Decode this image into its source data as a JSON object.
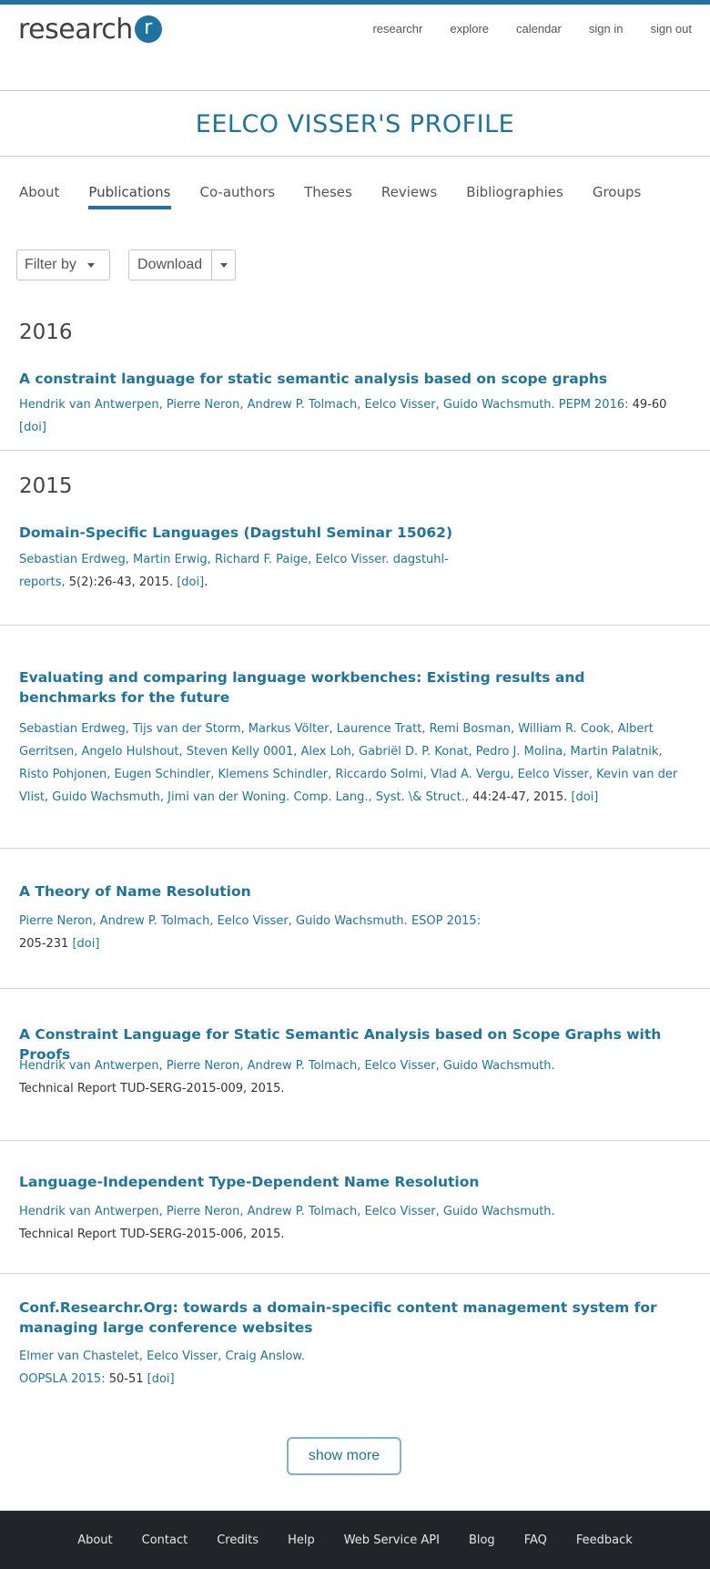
{
  "logo": {
    "text": "research",
    "badge": "r"
  },
  "topnav": [
    "researchr",
    "explore",
    "calendar",
    "sign in",
    "sign out"
  ],
  "page_title": "EELCO VISSER'S PROFILE",
  "tabs": [
    {
      "label": "About",
      "active": false
    },
    {
      "label": "Publications",
      "active": true
    },
    {
      "label": "Co-authors",
      "active": false
    },
    {
      "label": "Theses",
      "active": false
    },
    {
      "label": "Reviews",
      "active": false
    },
    {
      "label": "Bibliographies",
      "active": false
    },
    {
      "label": "Groups",
      "active": false
    }
  ],
  "filter_label": "Filter by",
  "download_label": "Download",
  "years": [
    "2016",
    "2015"
  ],
  "pubs": [
    {
      "title": "A constraint language for static semantic analysis based on scope graphs",
      "authors": "Hendrik van Antwerpen, Pierre Neron, Andrew P. Tolmach, Eelco Visser, Guido Wachsmuth.",
      "venue": "PEPM 2016:",
      "rest": " 49-60 ",
      "doi": "[doi]"
    },
    {
      "title": "Domain-Specific Languages (Dagstuhl Seminar 15062)",
      "authors": "Sebastian Erdweg, Martin Erwig, Richard F. Paige, Eelco Visser.",
      "venue": "dagstuhl-reports,",
      "rest": "5(2):26-43, 2015. ",
      "doi": "[doi]",
      "tail": "."
    },
    {
      "title": "Evaluating and comparing language workbenches: Existing results and benchmarks for the future",
      "authors": "Sebastian Erdweg, Tijs van der Storm, Markus Völter, Laurence Tratt, Remi Bosman, William R. Cook, Albert Gerritsen, Angelo Hulshout, Steven Kelly 0001, Alex Loh, Gabriël D. P. Konat, Pedro J. Molina, Martin Palatnik, Risto Pohjonen, Eugen Schindler, Klemens Schindler, Riccardo Solmi, Vlad A. Vergu, Eelco Visser, Kevin van der Vlist, Guido Wachsmuth, Jimi van der Woning.",
      "venue": "Comp. Lang., Syst. \\& Struct.,",
      "rest": " 44:24-47, 2015. ",
      "doi": "[doi]"
    },
    {
      "title": "A Theory of Name Resolution",
      "authors": "Pierre Neron, Andrew P. Tolmach, Eelco Visser, Guido Wachsmuth.",
      "venue": "ESOP 2015:",
      "rest": "205-231 ",
      "doi": "[doi]"
    },
    {
      "title": "A Constraint Language for Static Semantic Analysis based on Scope Graphs with Proofs",
      "authors": "Hendrik van Antwerpen, Pierre Neron, Andrew P. Tolmach, Eelco Visser, Guido Wachsmuth.",
      "rest": "Technical Report TUD-SERG-2015-009, 2015."
    },
    {
      "title": "Language-Independent Type-Dependent Name Resolution",
      "authors": "Hendrik van Antwerpen, Pierre Neron, Andrew P. Tolmach, Eelco Visser, Guido Wachsmuth.",
      "rest": "Technical Report TUD-SERG-2015-006, 2015."
    },
    {
      "title": "Conf.Researchr.Org: towards a domain-specific content management system for managing large conference websites",
      "authors": "Elmer van Chastelet, Eelco Visser, Craig Anslow.",
      "venue": "OOPSLA 2015:",
      "rest": " 50-51 ",
      "doi": "[doi]"
    }
  ],
  "show_more": "show more",
  "footer": [
    "About",
    "Contact",
    "Credits",
    "Help",
    "Web Service API",
    "Blog",
    "FAQ",
    "Feedback"
  ]
}
